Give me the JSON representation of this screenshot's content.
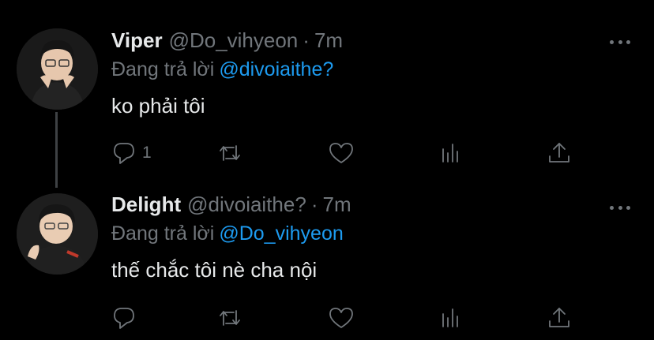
{
  "tweets": [
    {
      "name": "Viper",
      "handle": "@Do_vihyeon",
      "separator": "·",
      "time": "7m",
      "reply_prefix": "Đang trả lời",
      "reply_to": "@divoiaithe?",
      "text": "ko phải tôi",
      "reply_count": "1"
    },
    {
      "name": "Delight",
      "handle": "@divoiaithe?",
      "separator": "·",
      "time": "7m",
      "reply_prefix": "Đang trả lời",
      "reply_to": "@Do_vihyeon",
      "text": "thế chắc tôi nè cha nội",
      "reply_count": ""
    }
  ],
  "icons": {
    "reply": "comment-icon",
    "retweet": "retweet-icon",
    "like": "heart-icon",
    "stats": "analytics-icon",
    "share": "share-icon",
    "more": "more-icon"
  },
  "colors": {
    "background": "#000000",
    "text": "#e7e9ea",
    "muted": "#71767b",
    "link": "#1d9bf0"
  }
}
